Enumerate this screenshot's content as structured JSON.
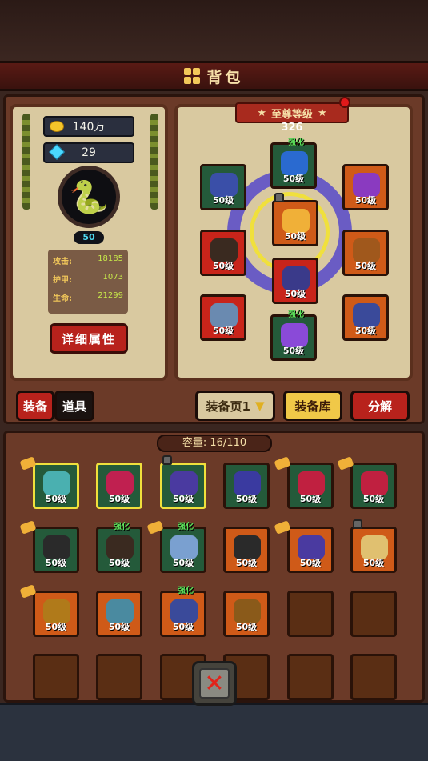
{
  "title": "背包",
  "resources": {
    "gold": "140万",
    "gems": "29"
  },
  "player": {
    "level": "50"
  },
  "stats": [
    {
      "label": "攻击:",
      "value": "18185"
    },
    {
      "label": "护甲:",
      "value": "1073"
    },
    {
      "label": "生命:",
      "value": "21299"
    }
  ],
  "buttons": {
    "details": "详细属性",
    "equip_page": "装备页1",
    "equip_storage": "装备库",
    "decompose": "分解"
  },
  "tabs": {
    "equip": "装备",
    "items": "道具"
  },
  "rank": {
    "title": "至尊等级",
    "value": "326"
  },
  "colors": {
    "accent_red": "#b8221c",
    "slot_green": "#245a3a",
    "slot_orange": "#cf5a18",
    "magic_circle": "#6a5cc4"
  },
  "equipped": [
    {
      "name": "chest-armor",
      "label": "50级",
      "color": "green",
      "art": "#3a4fa8"
    },
    {
      "name": "helmet",
      "label": "50级",
      "color": "green",
      "art": "#2a6ad0",
      "enhanced": "强化"
    },
    {
      "name": "amulet",
      "label": "50级",
      "color": "orange",
      "art": "#8a3ac0"
    },
    {
      "name": "gloves",
      "label": "50级",
      "color": "red",
      "art": "#3a2a20"
    },
    {
      "name": "belt",
      "label": "50级",
      "color": "orange",
      "art": "#f0b038",
      "locked": true
    },
    {
      "name": "ring",
      "label": "50级",
      "color": "orange",
      "art": "#a0581c"
    },
    {
      "name": "pants",
      "label": "50级",
      "color": "red",
      "art": "#3a3a8a"
    },
    {
      "name": "weapon",
      "label": "50级",
      "color": "red",
      "art": "#6a8ab0"
    },
    {
      "name": "boots",
      "label": "50级",
      "color": "green",
      "art": "#8a4ad8",
      "enhanced": "强化"
    },
    {
      "name": "sword",
      "label": "50级",
      "color": "orange",
      "art": "#3a4a9a"
    }
  ],
  "capacity": "容量: 16/110",
  "bag": [
    {
      "label": "50级",
      "color": "green",
      "art": "#4ab0b0",
      "selected": true,
      "tag": true
    },
    {
      "label": "50级",
      "color": "green",
      "art": "#c02050",
      "selected": true
    },
    {
      "label": "50级",
      "color": "green",
      "art": "#4a3aa0",
      "selected": true,
      "locked": true
    },
    {
      "label": "50级",
      "color": "green",
      "art": "#3a3aa0"
    },
    {
      "label": "50级",
      "color": "green",
      "art": "#c02040",
      "tag": true
    },
    {
      "label": "50级",
      "color": "green",
      "art": "#c02040",
      "tag": true
    },
    {
      "label": "50级",
      "color": "green",
      "art": "#2a2a2a",
      "tag": true
    },
    {
      "label": "50级",
      "color": "green",
      "art": "#3a2a20",
      "enhanced": "强化"
    },
    {
      "label": "50级",
      "color": "green",
      "art": "#7aa0d0",
      "enhanced": "强化",
      "tag": true
    },
    {
      "label": "50级",
      "color": "orange",
      "art": "#2a2a2a"
    },
    {
      "label": "50级",
      "color": "orange",
      "art": "#4a3aa0",
      "tag": true
    },
    {
      "label": "50级",
      "color": "orange",
      "art": "#e0c070",
      "locked": true
    },
    {
      "label": "50级",
      "color": "orange",
      "art": "#b07a1a",
      "tag": true
    },
    {
      "label": "50级",
      "color": "orange",
      "art": "#4a8aa0"
    },
    {
      "label": "50级",
      "color": "orange",
      "art": "#3a4a9a",
      "enhanced": "强化"
    },
    {
      "label": "50级",
      "color": "orange",
      "art": "#8a5a1a"
    },
    {
      "label": "",
      "color": "empty"
    },
    {
      "label": "",
      "color": "empty"
    },
    {
      "label": "",
      "color": "empty"
    },
    {
      "label": "",
      "color": "empty"
    },
    {
      "label": "",
      "color": "empty"
    },
    {
      "label": "",
      "color": "empty"
    },
    {
      "label": "",
      "color": "empty"
    },
    {
      "label": "",
      "color": "empty"
    }
  ]
}
